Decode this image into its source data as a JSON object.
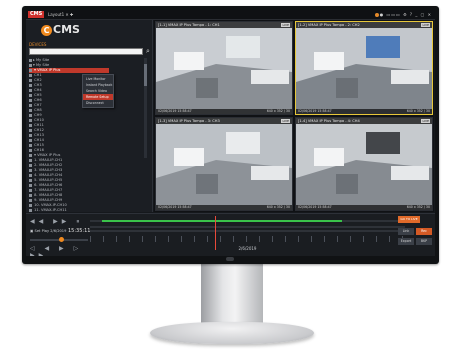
{
  "titlebar": {
    "app_logo": "CMS",
    "tab_label": "Layout1 ✕  ✚",
    "right_controls": "● ▭▭▭ ⚙ ? _ ▢ ✕"
  },
  "sidebar": {
    "brand_mark": "C",
    "brand_text": "CMS",
    "brand_sub": "DEVICES",
    "search_placeholder": "",
    "tree": [
      {
        "label": "▸ My Site",
        "selected": false
      },
      {
        "label": "▾ My Site",
        "selected": false
      },
      {
        "label": "  ▾ VMAX IP Plus",
        "selected": true
      },
      {
        "label": "    CH1",
        "selected": false
      },
      {
        "label": "    CH2",
        "selected": false
      },
      {
        "label": "    CH3",
        "selected": false
      },
      {
        "label": "    CH4",
        "selected": false
      },
      {
        "label": "    CH5",
        "selected": false
      },
      {
        "label": "    CH6",
        "selected": false
      },
      {
        "label": "    CH7",
        "selected": false
      },
      {
        "label": "    CH8",
        "selected": false
      },
      {
        "label": "    CH9",
        "selected": false
      },
      {
        "label": "    CH10",
        "selected": false
      },
      {
        "label": "    CH11",
        "selected": false
      },
      {
        "label": "    CH12",
        "selected": false
      },
      {
        "label": "    CH13",
        "selected": false
      },
      {
        "label": "    CH14",
        "selected": false
      },
      {
        "label": "    CH15",
        "selected": false
      },
      {
        "label": "    CH16",
        "selected": false
      },
      {
        "label": "  ▾ VMAX IP Plus",
        "selected": false
      },
      {
        "label": "    1. VMAX-IP-CH1",
        "selected": false
      },
      {
        "label": "    2. VMAX-IP-CH2",
        "selected": false
      },
      {
        "label": "    3. VMAX-IP-CH3",
        "selected": false
      },
      {
        "label": "    4. VMAX-IP-CH4",
        "selected": false
      },
      {
        "label": "    5. VMAX-IP-CH5",
        "selected": false
      },
      {
        "label": "    6. VMAX-IP-CH6",
        "selected": false
      },
      {
        "label": "    7. VMAX-IP-CH7",
        "selected": false
      },
      {
        "label": "    8. VMAX-IP-CH8",
        "selected": false
      },
      {
        "label": "    9. VMAX-IP-CH9",
        "selected": false
      },
      {
        "label": "    10. VMAX-IP-CH10",
        "selected": false
      },
      {
        "label": "    11. VMAX-IP-CH11",
        "selected": false
      }
    ],
    "context_menu": [
      {
        "label": "Live Monitor",
        "active": false
      },
      {
        "label": "Instant Playback",
        "active": false
      },
      {
        "label": "Search Video",
        "active": false
      },
      {
        "label": "Remote Setup",
        "active": true
      },
      {
        "label": "Disconnect",
        "active": false
      }
    ]
  },
  "video_tiles": [
    {
      "title": "[1-1] VMAX IP Plus Tampa - 1: CH1",
      "badge": "LIVE",
      "timestamp": "02/06/2019 15:58:47",
      "resolution": "640 x 352 / 30",
      "active": false,
      "scene": {
        "wall": "#c9cdd2",
        "floor": "#8a8f95",
        "accent": "#e9ecef"
      }
    },
    {
      "title": "[1-2] VMAX IP Plus Tampa - 2: CH2",
      "badge": "LIVE",
      "timestamp": "02/06/2019 15:58:47",
      "resolution": "640 x 352 / 30",
      "active": true,
      "scene": {
        "wall": "#c3c7cc",
        "floor": "#7f858c",
        "accent": "#3b6fb6"
      }
    },
    {
      "title": "[1-3] VMAX IP Plus Tampa - 3: CH3",
      "badge": "LIVE",
      "timestamp": "02/06/2019 15:58:47",
      "resolution": "640 x 352 / 30",
      "active": false,
      "scene": {
        "wall": "#bcc1c6",
        "floor": "#8d9298",
        "accent": "#f1f2f3"
      }
    },
    {
      "title": "[1-4] VMAX IP Plus Tampa - 4: CH4",
      "badge": "LIVE",
      "timestamp": "02/06/2019 15:58:47",
      "resolution": "640 x 352 / 30",
      "active": false,
      "scene": {
        "wall": "#c6cace",
        "floor": "#868b91",
        "accent": "#2c2f33"
      }
    }
  ],
  "timeline": {
    "transport_top": "◀◀ ▶▶ ⏸",
    "transport_bottom": "◁ ◀ ▶ ▷ ▶▶",
    "date": "▣ Set Play  2/6/2019",
    "time": "15:35:11",
    "speed_level_percent": 55,
    "track_label": "2/6/2019",
    "orange_button": "GO TO LIVE",
    "button_labels": [
      "Link",
      "Rec",
      "Export",
      "BKP"
    ],
    "recording_fraction": 0.8
  },
  "colors": {
    "accent": "#f08a1f",
    "selection": "#c0392b",
    "active_tile_border": "#e7c73a",
    "recording": "#3ac24a"
  }
}
